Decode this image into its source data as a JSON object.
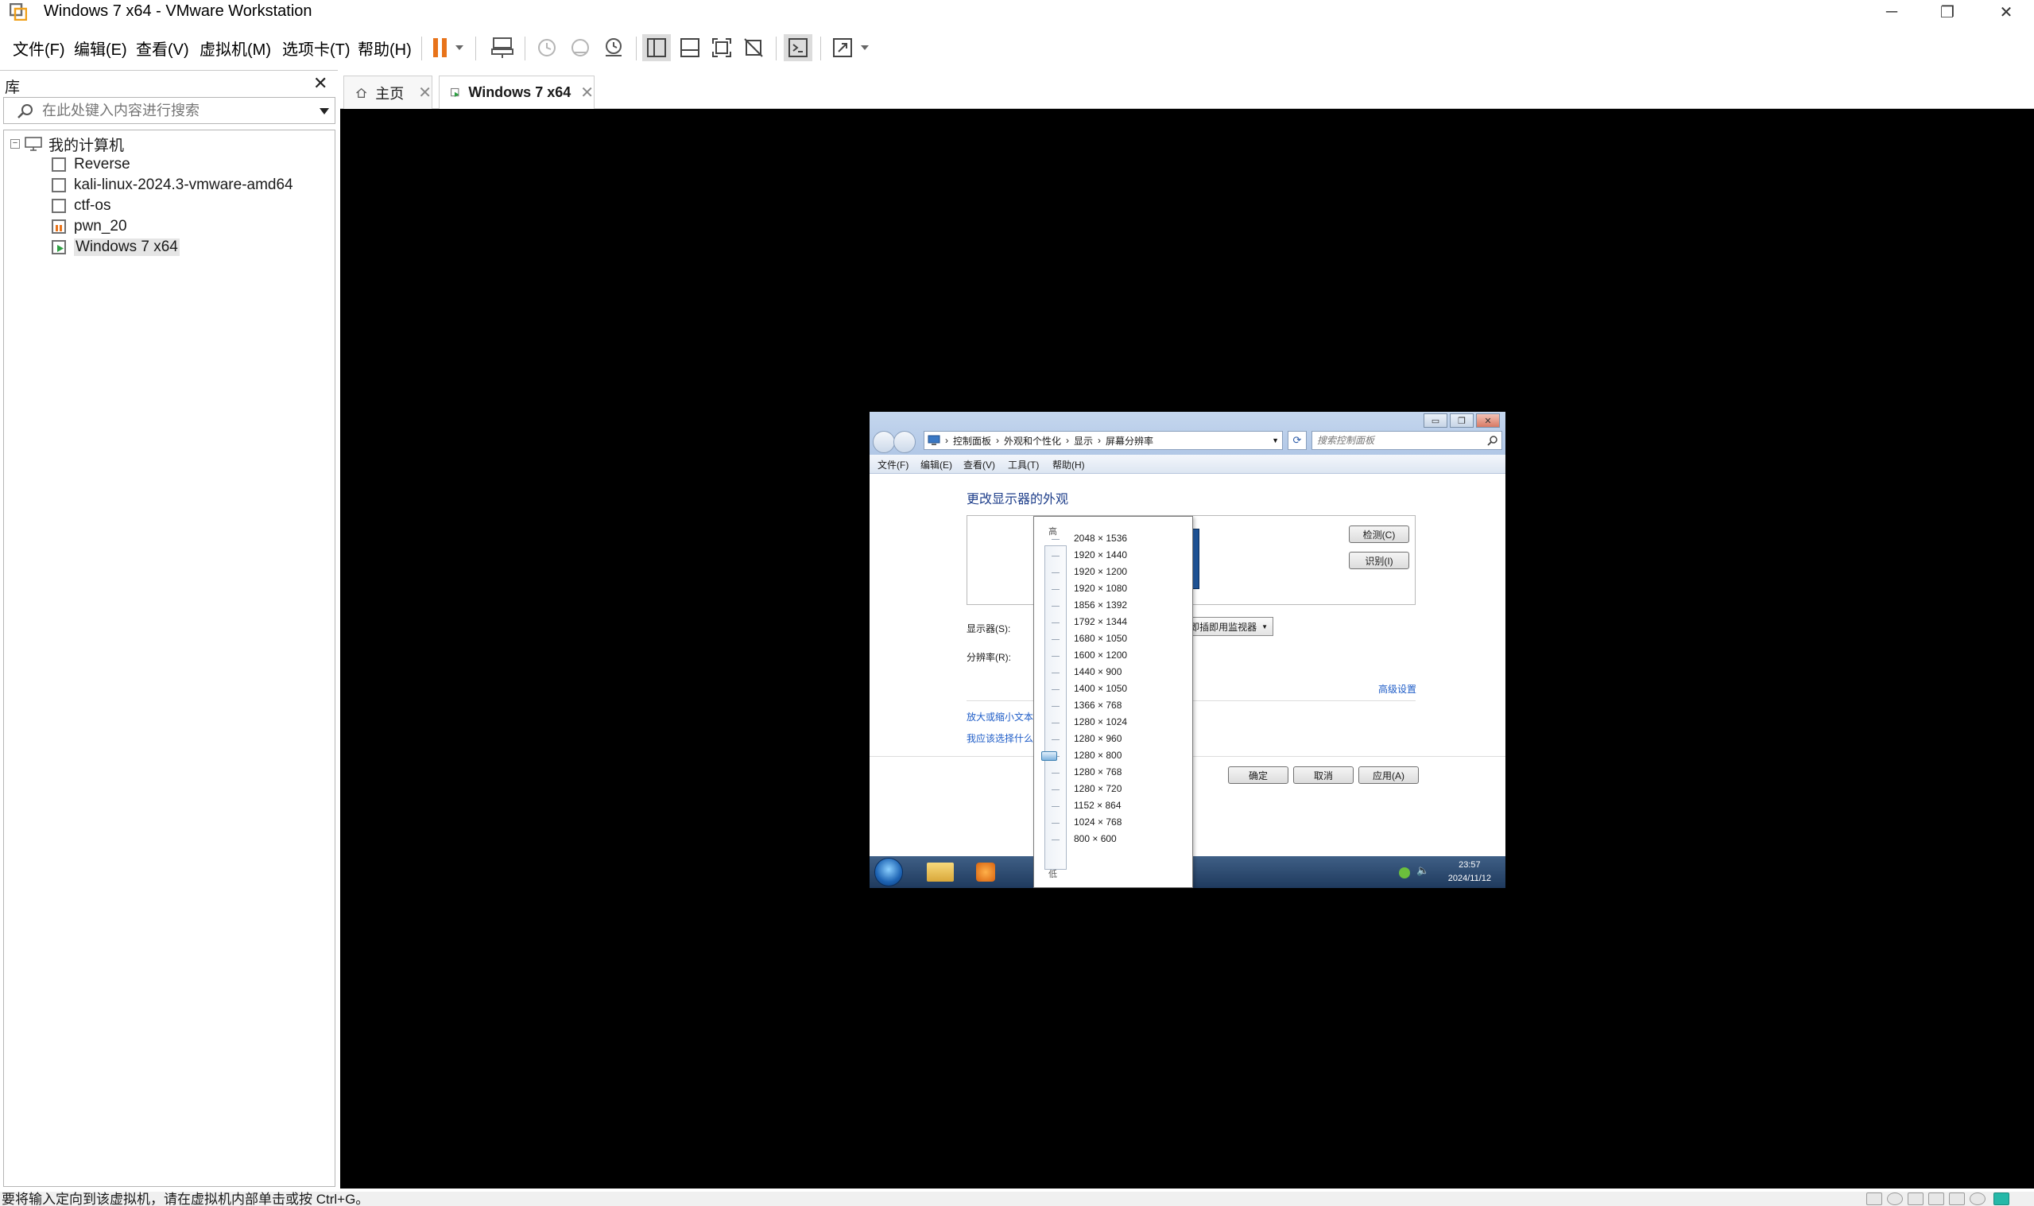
{
  "window": {
    "title": "Windows 7 x64 - VMware Workstation",
    "minimize_glyph": "─",
    "restore_glyph": "❐",
    "close_glyph": "✕"
  },
  "menu": {
    "file": "文件(F)",
    "edit": "编辑(E)",
    "view": "查看(V)",
    "vm": "虚拟机(M)",
    "tabs": "选项卡(T)",
    "help": "帮助(H)"
  },
  "toolbar_icons": [
    "pause-icon",
    "send-ctrl-alt-del-icon",
    "snapshot-take-icon",
    "snapshot-revert-icon",
    "snapshot-manager-icon",
    "library-view-icon",
    "thumbnail-bar-icon",
    "full-screen-icon",
    "unity-icon",
    "console-view-icon",
    "stretch-guest-icon"
  ],
  "library": {
    "title": "库",
    "close_glyph": "✕",
    "search_placeholder": "在此处键入内容进行搜索",
    "root": "我的计算机",
    "items": [
      {
        "label": "Reverse"
      },
      {
        "label": "kali-linux-2024.3-vmware-amd64"
      },
      {
        "label": "ctf-os"
      },
      {
        "label": "pwn_20"
      },
      {
        "label": "Windows 7 x64"
      }
    ]
  },
  "tabs": {
    "home": "主页",
    "vm": "Windows 7 x64"
  },
  "guest": {
    "breadcrumb": [
      "控制面板",
      "外观和个性化",
      "显示",
      "屏幕分辨率"
    ],
    "search_placeholder": "搜索控制面板",
    "menu": [
      "文件(F)",
      "编辑(E)",
      "查看(V)",
      "工具(T)",
      "帮助(H)"
    ],
    "heading": "更改显示器的外观",
    "detect_button": "检测(C)",
    "identify_button": "识别(I)",
    "display_label": "显示器(S):",
    "display_value": "即插即用监视器",
    "resolution_label": "分辨率(R):",
    "advanced_link": "高级设置",
    "link_text_size": "放大或缩小文本",
    "link_choose": "我应该选择什么",
    "ok_button": "确定",
    "cancel_button": "取消",
    "apply_button": "应用(A)",
    "slider_high": "高",
    "slider_low": "低",
    "resolutions": [
      "2048 × 1536",
      "1920 × 1440",
      "1920 × 1200",
      "1920 × 1080",
      "1856 × 1392",
      "1792 × 1344",
      "1680 × 1050",
      "1600 × 1200",
      "1440 × 900",
      "1400 × 1050",
      "1366 × 768",
      "1280 × 1024",
      "1280 × 960",
      "1280 × 800",
      "1280 × 768",
      "1280 × 720",
      "1152 × 864",
      "1024 × 768",
      "800 × 600"
    ],
    "selected_resolution": "1280 × 800",
    "clock_time": "23:57",
    "clock_date": "2024/11/12"
  },
  "statusbar": {
    "message": "要将输入定向到该虚拟机，请在虚拟机内部单击或按 Ctrl+G。"
  },
  "colors": {
    "accent_orange": "#e8731a",
    "vm_background": "#000000",
    "taskbar": "#2a4a72",
    "link": "#1e5cc7"
  }
}
